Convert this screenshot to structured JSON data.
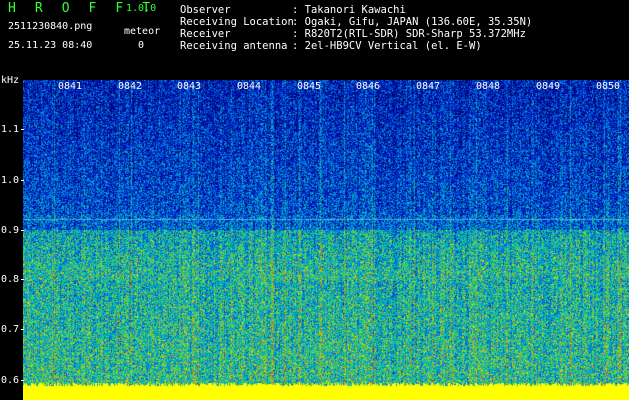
{
  "app": {
    "title": "H R O F F T",
    "version": "1.0.0"
  },
  "file": {
    "name": "2511230840.png",
    "datetime": "25.11.23 08:40"
  },
  "meteor": {
    "label": "meteor",
    "count": "0"
  },
  "info": [
    {
      "label": "Observer",
      "value": ": Takanori Kawachi"
    },
    {
      "label": "Receiving Location",
      "value": ": Ogaki, Gifu, JAPAN (136.60E, 35.35N)"
    },
    {
      "label": "Receiver",
      "value": ": R820T2(RTL-SDR) SDR-Sharp 53.372MHz"
    },
    {
      "label": "Receiving antenna",
      "value": ": 2el-HB9CV Vertical (el. E-W)"
    }
  ],
  "axes": {
    "y_unit": "kHz",
    "y_ticks": [
      "1.1",
      "1.0",
      "0.9",
      "0.8",
      "0.7",
      "0.6"
    ],
    "x_ticks": [
      "0841",
      "0842",
      "0843",
      "0844",
      "0845",
      "0846",
      "0847",
      "0848",
      "0849",
      "0850"
    ]
  },
  "colors": {
    "title": "#33ff33",
    "background": "#000000",
    "baseline": "#ffff00"
  }
}
